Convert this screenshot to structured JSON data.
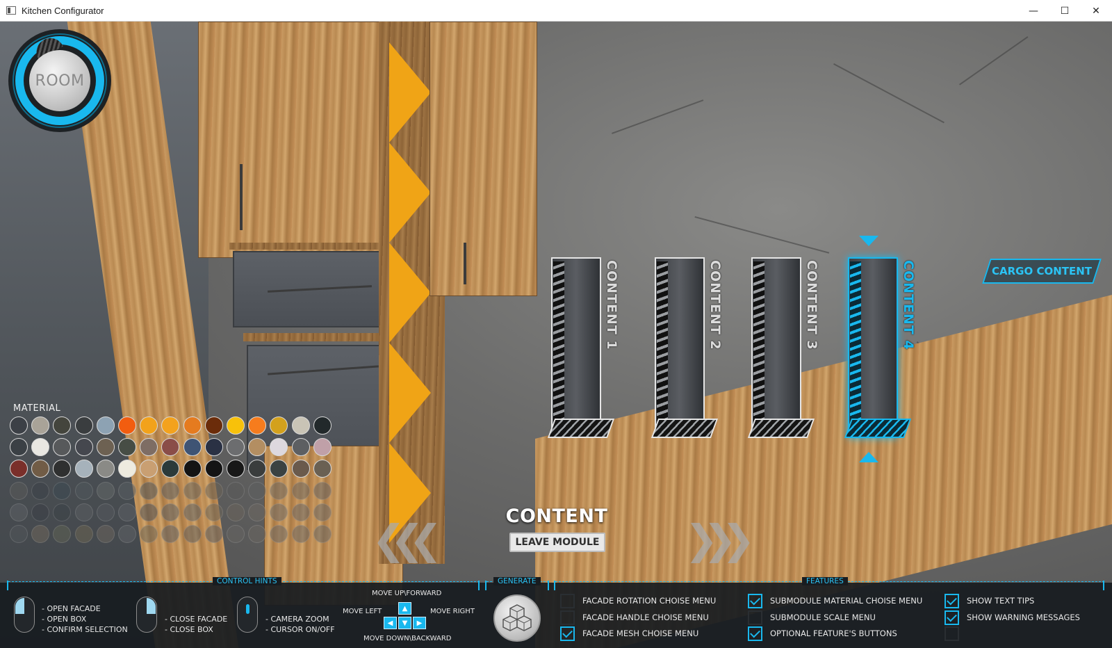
{
  "window": {
    "title": "Kitchen Configurator",
    "controls": {
      "minimize": "—",
      "maximize": "☐",
      "close": "✕"
    }
  },
  "room_dial": {
    "label": "ROOM"
  },
  "material": {
    "label": "MATERIAL",
    "rows": [
      [
        "#3c4046",
        "#a9a398",
        "#44453d",
        "#3a3d3f",
        "#8da2b3",
        "#f25d10",
        "#f2a21b",
        "#f3a21d",
        "#e57b1f",
        "#6b2c0a",
        "#f8c10a",
        "#f67c1d",
        "#d3a11d",
        "#c9c4b6",
        "#22292b"
      ],
      [
        "#3b4045",
        "#e9e7e2",
        "#57595b",
        "#45474e",
        "#6d6152",
        "#474d45",
        "#7e6d64",
        "#8a4d48",
        "#3f5474",
        "#2a3144",
        "#6c6d6f",
        "#b38e62",
        "#ddd8de",
        "#5d5f62",
        "#c0a0a8"
      ],
      [
        "#7a2f2a",
        "#715c46",
        "#2f3030",
        "#a6b2bb",
        "#8a8a86",
        "#eeebdf",
        "#c99f72",
        "#2c3a3a",
        "#141414",
        "#141414",
        "#181818",
        "#3a3d3d",
        "#3a4242",
        "#6a5a4c",
        "#6a6053"
      ],
      [
        "#5a5a5a",
        "#3c4248",
        "#3c4a52",
        "#50585c",
        "#636868",
        "#585e62",
        "#50565a",
        "#5c5e60",
        "#6b665d",
        "#6a6256",
        "#5a5a5a",
        "#5d5f60",
        "#6e6860",
        "#6d665e",
        "#676260"
      ],
      [
        "#5c6064",
        "#3b4046",
        "#3c4247",
        "#5a5e62",
        "#55595e",
        "#5c6065",
        "#4d5156",
        "#5c5f62",
        "#5f6264",
        "#6c6559",
        "#6a645b",
        "#6d6862",
        "#6e6a66",
        "#6a6664",
        "#6b6764"
      ],
      [
        "#51555a",
        "#6e675b",
        "#5f6254",
        "#6b6452",
        "#6b655e",
        "#5f6266",
        "#6d6758",
        "#5f6164",
        "#615f5c",
        "#5c5e62",
        "#666462",
        "#6a6661",
        "#6b6764",
        "#6b6764",
        "#6a6763"
      ]
    ]
  },
  "modules": [
    {
      "label": "CONTENT 1",
      "selected": false
    },
    {
      "label": "CONTENT 2",
      "selected": false
    },
    {
      "label": "CONTENT 3",
      "selected": false
    },
    {
      "label": "CONTENT 4",
      "selected": true
    }
  ],
  "cargo_button": "CARGO CONTENT",
  "center": {
    "title": "CONTENT",
    "leave_button": "LEAVE MODULE",
    "prev_arrow": "❮❮❮",
    "next_arrow": "❯❯❯"
  },
  "panel": {
    "control_hints_title": "CONTROL HINTS",
    "generate_title": "GENERATE",
    "features_title": "FEATURES",
    "hints": {
      "left_click": "- OPEN FACADE\n- OPEN BOX\n- CONFIRM SELECTION",
      "right_click": "- CLOSE FACADE\n- CLOSE BOX",
      "wheel": "- CAMERA ZOOM\n- CURSOR ON/OFF",
      "move_up": "MOVE UP\\FORWARD",
      "move_left": "MOVE LEFT",
      "move_right": "MOVE RIGHT",
      "move_down": "MOVE DOWN\\BACKWARD"
    },
    "features": [
      {
        "label": "FACADE ROTATION CHOISE MENU",
        "checked": false
      },
      {
        "label": "FACADE HANDLE CHOISE MENU",
        "checked": false
      },
      {
        "label": "FACADE MESH CHOISE MENU",
        "checked": true
      },
      {
        "label": "SUBMODULE MATERIAL CHOISE MENU",
        "checked": true
      },
      {
        "label": "SUBMODULE SCALE MENU",
        "checked": false
      },
      {
        "label": "OPTIONAL FEATURE'S BUTTONS",
        "checked": true
      },
      {
        "label": "SHOW TEXT TIPS",
        "checked": true
      },
      {
        "label": "SHOW WARNING MESSAGES",
        "checked": true
      },
      {
        "label": "",
        "checked": false
      }
    ]
  }
}
